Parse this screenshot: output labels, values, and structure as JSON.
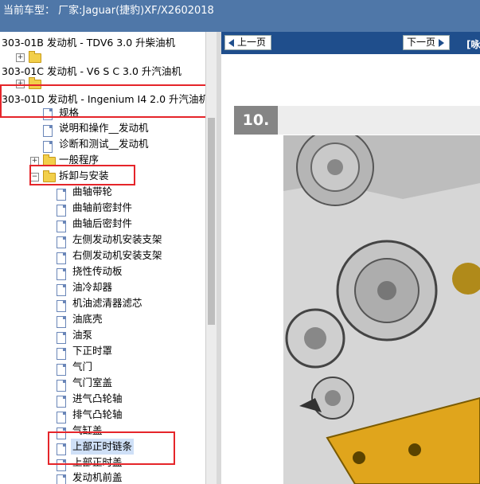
{
  "header": {
    "title": "当前车型： 厂家:Jaguar(捷豹)XF/X2602018"
  },
  "nav": {
    "prev_label": "上一页",
    "next_label": "下一页",
    "extra_label": "[咏"
  },
  "step": {
    "number": "10."
  },
  "tree": {
    "items": [
      {
        "label": "303-01B 发动机 - TDV6 3.0 升柴油机"
      },
      {
        "label": ""
      },
      {
        "label": "303-01C 发动机 - V6 S C 3.0 升汽油机"
      },
      {
        "label": ""
      },
      {
        "label": "303-01D 发动机 - Ingenium I4 2.0 升汽油机"
      },
      {
        "label": "规格"
      },
      {
        "label": "说明和操作__发动机"
      },
      {
        "label": "诊断和测试__发动机"
      },
      {
        "label": "一般程序"
      },
      {
        "label": "拆卸与安装"
      },
      {
        "label": "曲轴带轮"
      },
      {
        "label": "曲轴前密封件"
      },
      {
        "label": "曲轴后密封件"
      },
      {
        "label": "左侧发动机安装支架"
      },
      {
        "label": "右侧发动机安装支架"
      },
      {
        "label": "挠性传动板"
      },
      {
        "label": "油冷却器"
      },
      {
        "label": "机油滤清器滤芯"
      },
      {
        "label": "油底壳"
      },
      {
        "label": "油泵"
      },
      {
        "label": "下正时罩"
      },
      {
        "label": "气门"
      },
      {
        "label": "气门室盖"
      },
      {
        "label": "进气凸轮轴"
      },
      {
        "label": "排气凸轮轴"
      },
      {
        "label": "气缸盖"
      },
      {
        "label": "上部正时链条"
      },
      {
        "label": "上部正时盖"
      },
      {
        "label": "发动机前盖"
      }
    ]
  },
  "colors": {
    "header_bg": "#4f77a8",
    "nav_bg": "#1f4e8c",
    "highlight": "#e5252a"
  }
}
